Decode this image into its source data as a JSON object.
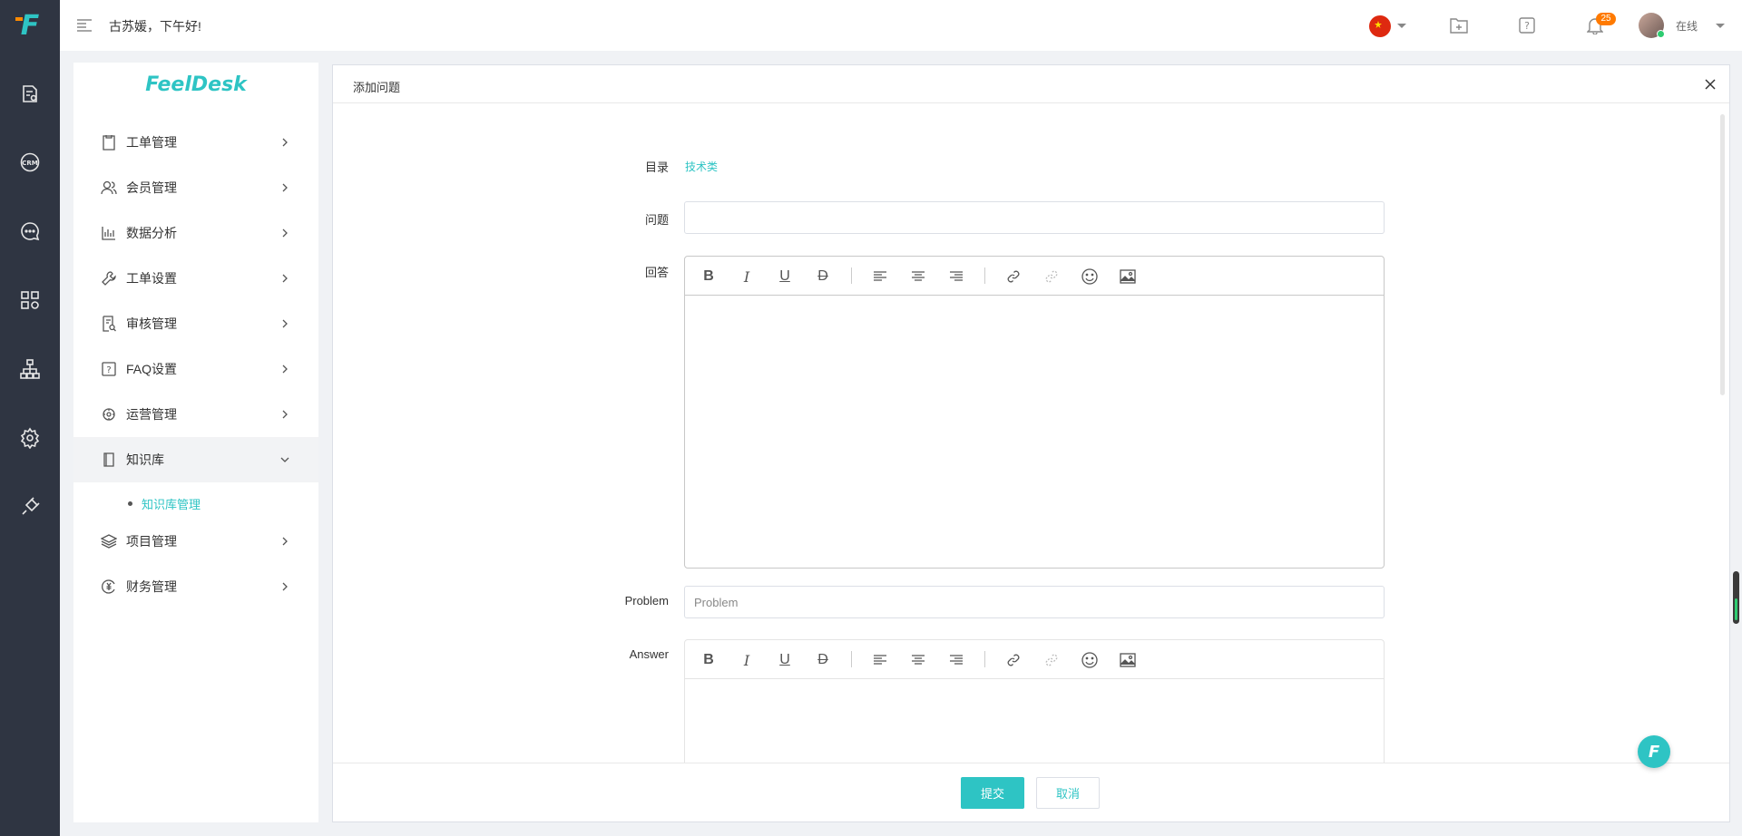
{
  "app": {
    "logo_text": "F",
    "brand_text": "FeelDesk"
  },
  "topbar": {
    "greeting": "古苏媛，下午好!",
    "notification_count": "25",
    "status_label": "在线"
  },
  "rail_icons": [
    "ticket-settings-icon",
    "crm-icon",
    "chat-icon",
    "apps-icon",
    "org-chart-icon",
    "settings-icon",
    "plugin-icon"
  ],
  "sidebar": {
    "items": [
      {
        "label": "工单管理",
        "icon": "ticket-icon"
      },
      {
        "label": "会员管理",
        "icon": "members-icon"
      },
      {
        "label": "数据分析",
        "icon": "analytics-icon"
      },
      {
        "label": "工单设置",
        "icon": "wrench-icon"
      },
      {
        "label": "审核管理",
        "icon": "review-icon"
      },
      {
        "label": "FAQ设置",
        "icon": "faq-icon"
      },
      {
        "label": "运营管理",
        "icon": "operations-icon"
      },
      {
        "label": "知识库",
        "icon": "book-icon"
      },
      {
        "label": "项目管理",
        "icon": "layers-icon"
      },
      {
        "label": "财务管理",
        "icon": "finance-icon"
      }
    ],
    "sub_item": "知识库管理"
  },
  "dialog": {
    "title": "添加问题",
    "directory_label": "目录",
    "directory_value": "技术类",
    "question_label": "问题",
    "question_value": "",
    "answer_label": "回答",
    "problem_label": "Problem",
    "problem_placeholder": "Problem",
    "en_answer_label": "Answer",
    "submit_label": "提交",
    "cancel_label": "取消"
  },
  "toolbar_buttons": [
    "bold",
    "italic",
    "underline",
    "strikethrough",
    "align-left",
    "align-center",
    "align-right",
    "link",
    "unlink",
    "emoji",
    "image"
  ],
  "colors": {
    "accent": "#2ec4c4",
    "rail_bg": "#2f3542",
    "badge": "#ff7a00"
  }
}
